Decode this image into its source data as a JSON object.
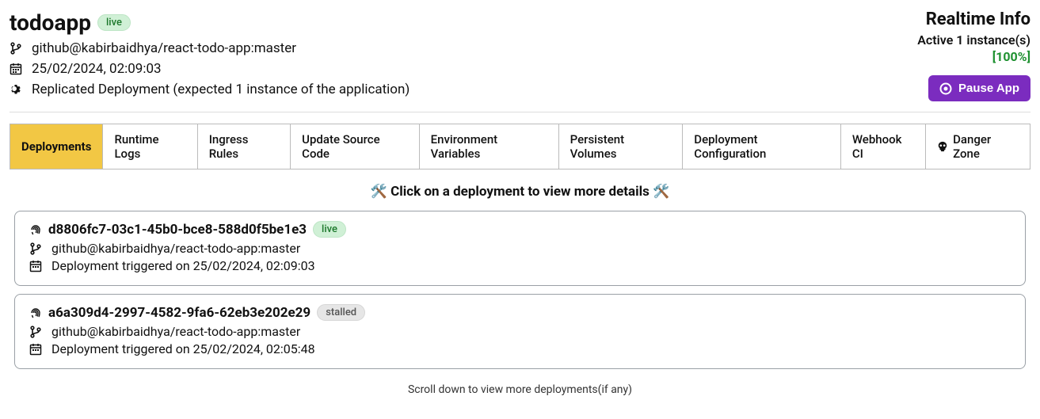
{
  "header": {
    "appName": "todoapp",
    "statusBadge": "live",
    "repo": "github@kabirbaidhya/react-todo-app:master",
    "timestamp": "25/02/2024, 02:09:03",
    "deploymentDesc": "Replicated Deployment (expected 1 instance of the application)"
  },
  "realtime": {
    "title": "Realtime Info",
    "active": "Active 1 instance(s)",
    "pct": "[100%]",
    "pauseLabel": "Pause App"
  },
  "tabs": [
    "Deployments",
    "Runtime Logs",
    "Ingress Rules",
    "Update Source Code",
    "Environment Variables",
    "Persistent Volumes",
    "Deployment Configuration",
    "Webhook CI",
    "Danger Zone"
  ],
  "hintPrefix": "🛠️ ",
  "hintText": "Click on a deployment to view more details",
  "hintSuffix": " 🛠️",
  "deployments": [
    {
      "id": "d8806fc7-03c1-45b0-bce8-588d0f5be1e3",
      "status": "live",
      "repo": "github@kabirbaidhya/react-todo-app:master",
      "trigger": "Deployment triggered on 25/02/2024, 02:09:03"
    },
    {
      "id": "a6a309d4-2997-4582-9fa6-62eb3e202e29",
      "status": "stalled",
      "repo": "github@kabirbaidhya/react-todo-app:master",
      "trigger": "Deployment triggered on 25/02/2024, 02:05:48"
    }
  ],
  "scrollNote": "Scroll down to view more deployments(if any)"
}
